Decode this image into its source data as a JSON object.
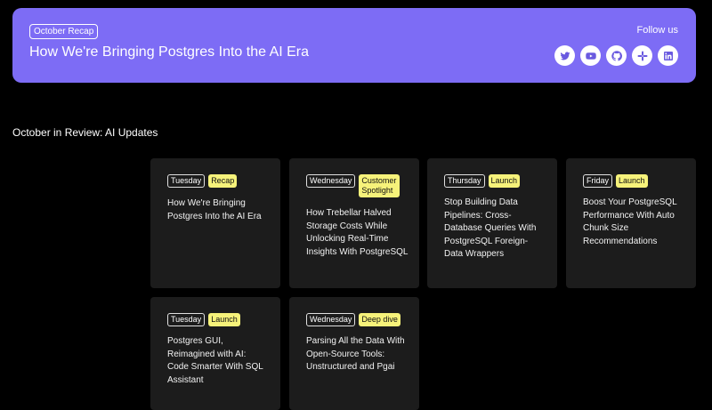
{
  "hero": {
    "badge": "October Recap",
    "title": "How We're Bringing Postgres Into the AI Era",
    "follow_label": "Follow us",
    "socials": [
      "twitter-icon",
      "youtube-icon",
      "github-icon",
      "slack-icon",
      "linkedin-icon"
    ]
  },
  "section": {
    "title": "October in Review: AI Updates"
  },
  "cards": [
    {
      "day": "Tuesday",
      "type": "Recap",
      "title": "How We're Bringing Postgres Into the AI Era"
    },
    {
      "day": "Wednesday",
      "type": "Customer Spotlight",
      "title": "How Trebellar Halved Storage Costs While Unlocking Real-Time Insights With PostgreSQL"
    },
    {
      "day": "Thursday",
      "type": "Launch",
      "title": "Stop Building Data Pipelines: Cross-Database Queries With PostgreSQL Foreign-Data Wrappers"
    },
    {
      "day": "Friday",
      "type": "Launch",
      "title": "Boost Your PostgreSQL Performance With Auto Chunk Size Recommendations"
    },
    {
      "day": "Tuesday",
      "type": "Launch",
      "title": "Postgres GUI, Reimagined with AI: Code Smarter With SQL Assistant"
    },
    {
      "day": "Wednesday",
      "type": "Deep dive",
      "title": "Parsing All the Data With Open-Source Tools: Unstructured and Pgai"
    }
  ],
  "colors": {
    "hero_bg": "#7d6cf5",
    "tag_bg": "#f6f27a",
    "card_bg": "#1c1c1c"
  }
}
